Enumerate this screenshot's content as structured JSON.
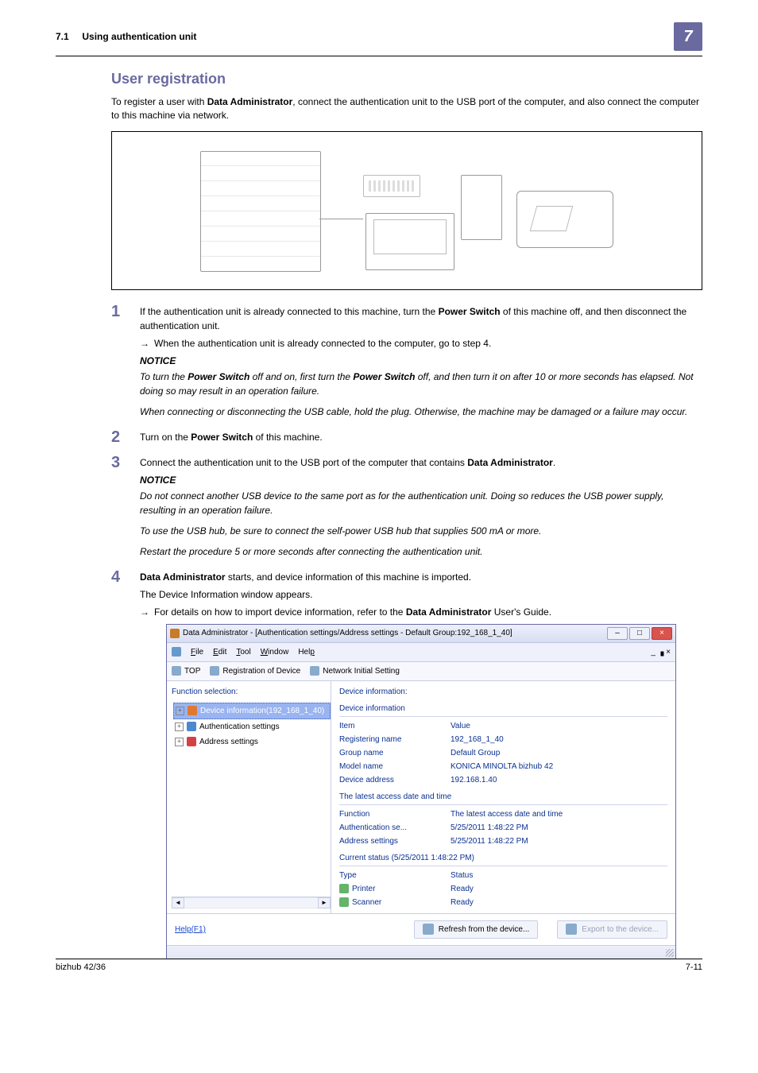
{
  "header": {
    "section_no": "7.1",
    "section_title": "Using authentication unit",
    "badge": "7"
  },
  "title": "User registration",
  "intro_before_bold": "To register a user with ",
  "intro_bold": "Data Administrator",
  "intro_after_bold": ", connect the authentication unit to the USB port of the computer, and also connect the computer to this machine via network.",
  "steps": {
    "s1": {
      "num": "1",
      "t1": "If the authentication unit is already connected to this machine, turn the ",
      "b1": "Power Switch",
      "t2": " of this machine off, and then disconnect the authentication unit.",
      "arrow": "When the authentication unit is already connected to the computer, go to step 4.",
      "notice": "NOTICE",
      "it1a": "To turn the ",
      "it1b": "Power Switch",
      "it1c": " off and on, first turn the ",
      "it1d": "Power Switch",
      "it1e": " off, and then turn it on after 10 or more seconds has elapsed. Not doing so may result in an operation failure.",
      "it2": "When connecting or disconnecting the USB cable, hold the plug. Otherwise, the machine may be damaged or a failure may occur."
    },
    "s2": {
      "num": "2",
      "t1": "Turn on the ",
      "b1": "Power Switch",
      "t2": " of this machine."
    },
    "s3": {
      "num": "3",
      "t1": "Connect the authentication unit to the USB port of the computer that contains ",
      "b1": "Data Administrator",
      "t2": ".",
      "notice": "NOTICE",
      "it1": "Do not connect another USB device to the same port as for the authentication unit. Doing so reduces the USB power supply, resulting in an operation failure.",
      "it2": "To use the USB hub, be sure to connect the self-power USB hub that supplies 500 mA or more.",
      "it3": "Restart the procedure 5 or more seconds after connecting the authentication unit."
    },
    "s4": {
      "num": "4",
      "b1": "Data Administrator",
      "t1": " starts, and device information of this machine is imported.",
      "sub": "The Device Information window appears.",
      "arrow_a": "For details on how to import device information, refer to the ",
      "arrow_b": "Data Administrator",
      "arrow_c": " User's Guide."
    }
  },
  "win": {
    "title": "Data Administrator - [Authentication settings/Address settings - Default Group:192_168_1_40]",
    "menus": {
      "file": "File",
      "edit": "Edit",
      "tool": "Tool",
      "window": "Window",
      "help": "Help"
    },
    "mdi": "_  ▗  ×",
    "toolbar": {
      "top": "TOP",
      "reg": "Registration of Device",
      "net": "Network Initial Setting"
    },
    "left": {
      "title": "Function selection:",
      "items": [
        {
          "label": "Device information(192_168_1_40)",
          "selected": true,
          "icon": "ic-dev"
        },
        {
          "label": "Authentication settings",
          "selected": false,
          "icon": "ic-auth"
        },
        {
          "label": "Address settings",
          "selected": false,
          "icon": "ic-addr"
        }
      ]
    },
    "right": {
      "title": "Device information:",
      "sec1": {
        "hdr": "Device information",
        "col1": "Item",
        "col2": "Value",
        "rows": [
          {
            "k": "Registering name",
            "v": "192_168_1_40"
          },
          {
            "k": "Group name",
            "v": "Default Group"
          },
          {
            "k": "Model name",
            "v": "KONICA MINOLTA bizhub 42"
          },
          {
            "k": "Device address",
            "v": "192.168.1.40"
          }
        ]
      },
      "sec2": {
        "hdr": "The latest access date and time",
        "col1": "Function",
        "col2": "The latest access date and time",
        "rows": [
          {
            "k": "Authentication se...",
            "v": "5/25/2011 1:48:22 PM"
          },
          {
            "k": "Address settings",
            "v": "5/25/2011 1:48:22 PM"
          }
        ]
      },
      "sec3": {
        "hdr": "Current status (5/25/2011 1:48:22 PM)",
        "col1": "Type",
        "col2": "Status",
        "rows": [
          {
            "k": "Printer",
            "v": "Ready"
          },
          {
            "k": "Scanner",
            "v": "Ready"
          }
        ]
      }
    },
    "help": "Help(F1)",
    "btn_refresh": "Refresh from the device...",
    "btn_export": "Export to the device..."
  },
  "footer": {
    "left": "bizhub 42/36",
    "right": "7-11"
  }
}
